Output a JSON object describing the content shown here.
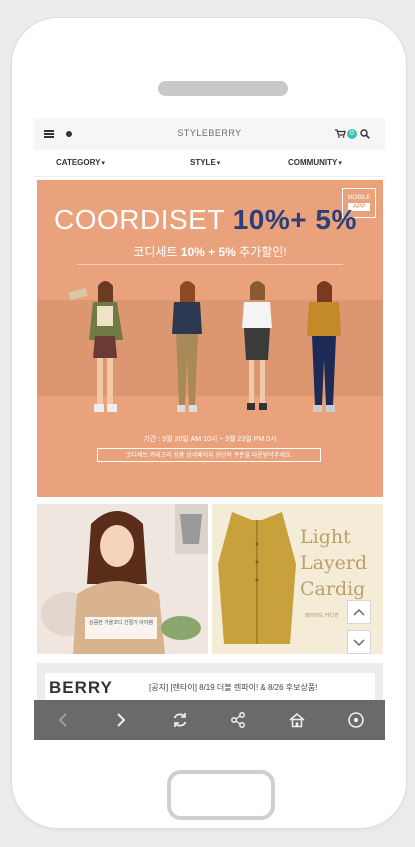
{
  "header": {
    "brand": "STYLEBERRY",
    "cart_count": "0"
  },
  "nav": {
    "items": [
      {
        "label": "CATEGORY"
      },
      {
        "label": "STYLE"
      },
      {
        "label": "COMMUNITY"
      }
    ]
  },
  "banner": {
    "title_text": "COORDISET ",
    "title_numbers": "10%+ 5%",
    "subtitle_pre": "코디세트 ",
    "subtitle_bold": "10% + 5%",
    "subtitle_post": " 추가할인!",
    "badge_top": "MOBILE",
    "badge_app": "APP",
    "period": "기간 : 9월 20일 AM 10시 ~ 9월 23일 PM 0시",
    "notice": "코디세트 카테고리 상품 상세페이지 상단의 쿠폰을 다운받아주세요."
  },
  "tiles": {
    "left_caption": "상큼한 가을코디\n간절기 아이템",
    "right_line1": "Light",
    "right_line2": "Layerd",
    "right_line3": "Cardig",
    "right_sub": "레이어드 카디건"
  },
  "news": {
    "logo": "BERRY",
    "text": "[공지] [렌타이] 8/19 더블 렌파이! & 8/26 후보상품!"
  },
  "colors": {
    "banner": "#e9a27b",
    "accent_number": "#2d3e7a",
    "badge": "#3cc0b4",
    "toolbar": "#6a6a6a"
  }
}
